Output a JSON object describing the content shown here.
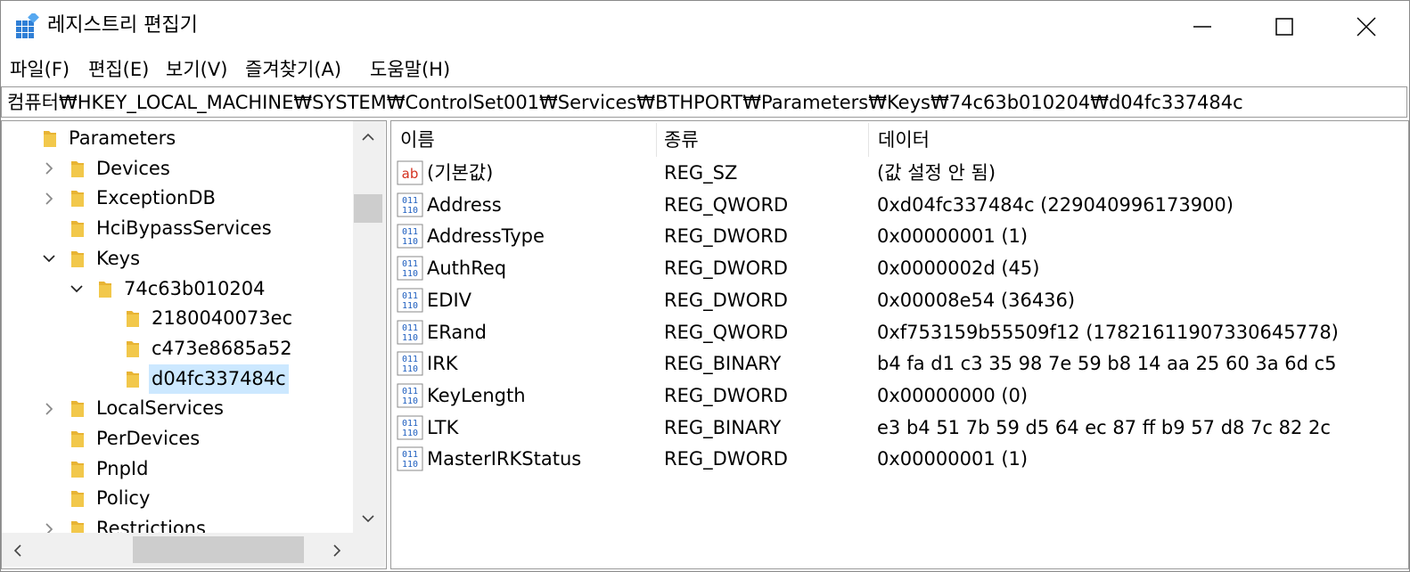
{
  "window": {
    "title": "레지스트리 편집기",
    "controls": {
      "minimize": "minimize-icon",
      "maximize": "maximize-icon",
      "close": "close-icon"
    }
  },
  "menu": [
    {
      "label": "파일(F)"
    },
    {
      "label": "편집(E)"
    },
    {
      "label": "보기(V)"
    },
    {
      "label": "즐겨찾기(A)"
    },
    {
      "label": "도움말(H)"
    }
  ],
  "address": "컴퓨터₩HKEY_LOCAL_MACHINE₩SYSTEM₩ControlSet001₩Services₩BTHPORT₩Parameters₩Keys₩74c63b010204₩d04fc337484c",
  "tree": [
    {
      "label": "Parameters",
      "depth": 0,
      "chevron": "none",
      "selected": false
    },
    {
      "label": "Devices",
      "depth": 1,
      "chevron": "right",
      "selected": false
    },
    {
      "label": "ExceptionDB",
      "depth": 1,
      "chevron": "right",
      "selected": false
    },
    {
      "label": "HciBypassServices",
      "depth": 1,
      "chevron": "none",
      "selected": false
    },
    {
      "label": "Keys",
      "depth": 1,
      "chevron": "down",
      "selected": false
    },
    {
      "label": "74c63b010204",
      "depth": 2,
      "chevron": "down",
      "selected": false
    },
    {
      "label": "2180040073ec",
      "depth": 3,
      "chevron": "none",
      "selected": false
    },
    {
      "label": "c473e8685a52",
      "depth": 3,
      "chevron": "none",
      "selected": false
    },
    {
      "label": "d04fc337484c",
      "depth": 3,
      "chevron": "none",
      "selected": true
    },
    {
      "label": "LocalServices",
      "depth": 1,
      "chevron": "right",
      "selected": false
    },
    {
      "label": "PerDevices",
      "depth": 1,
      "chevron": "none",
      "selected": false
    },
    {
      "label": "PnpId",
      "depth": 1,
      "chevron": "none",
      "selected": false
    },
    {
      "label": "Policy",
      "depth": 1,
      "chevron": "none",
      "selected": false
    },
    {
      "label": "Restrictions",
      "depth": 1,
      "chevron": "right",
      "selected": false
    }
  ],
  "columns": {
    "name": "이름",
    "type": "종류",
    "data": "데이터"
  },
  "values": [
    {
      "icon": "string",
      "name": "(기본값)",
      "type": "REG_SZ",
      "data": "(값 설정 안 됨)"
    },
    {
      "icon": "binary",
      "name": "Address",
      "type": "REG_QWORD",
      "data": "0xd04fc337484c (229040996173900)"
    },
    {
      "icon": "binary",
      "name": "AddressType",
      "type": "REG_DWORD",
      "data": "0x00000001 (1)"
    },
    {
      "icon": "binary",
      "name": "AuthReq",
      "type": "REG_DWORD",
      "data": "0x0000002d (45)"
    },
    {
      "icon": "binary",
      "name": "EDIV",
      "type": "REG_DWORD",
      "data": "0x00008e54 (36436)"
    },
    {
      "icon": "binary",
      "name": "ERand",
      "type": "REG_QWORD",
      "data": "0xf753159b55509f12 (17821611907330645778)"
    },
    {
      "icon": "binary",
      "name": "IRK",
      "type": "REG_BINARY",
      "data": "b4 fa d1 c3 35 98 7e 59 b8 14 aa 25 60 3a 6d c5"
    },
    {
      "icon": "binary",
      "name": "KeyLength",
      "type": "REG_DWORD",
      "data": "0x00000000 (0)"
    },
    {
      "icon": "binary",
      "name": "LTK",
      "type": "REG_BINARY",
      "data": "e3 b4 51 7b 59 d5 64 ec 87 ff b9 57 d8 7c 82 2c"
    },
    {
      "icon": "binary",
      "name": "MasterIRKStatus",
      "type": "REG_DWORD",
      "data": "0x00000001 (1)"
    }
  ],
  "icons": {
    "string_glyph": "ab",
    "binary_top": "011",
    "binary_bottom": "110"
  },
  "colors": {
    "selection": "#cce8ff",
    "folder": "#f2c84b",
    "string_icon_text": "#d4311f",
    "binary_icon_text": "#1f5fbf"
  }
}
